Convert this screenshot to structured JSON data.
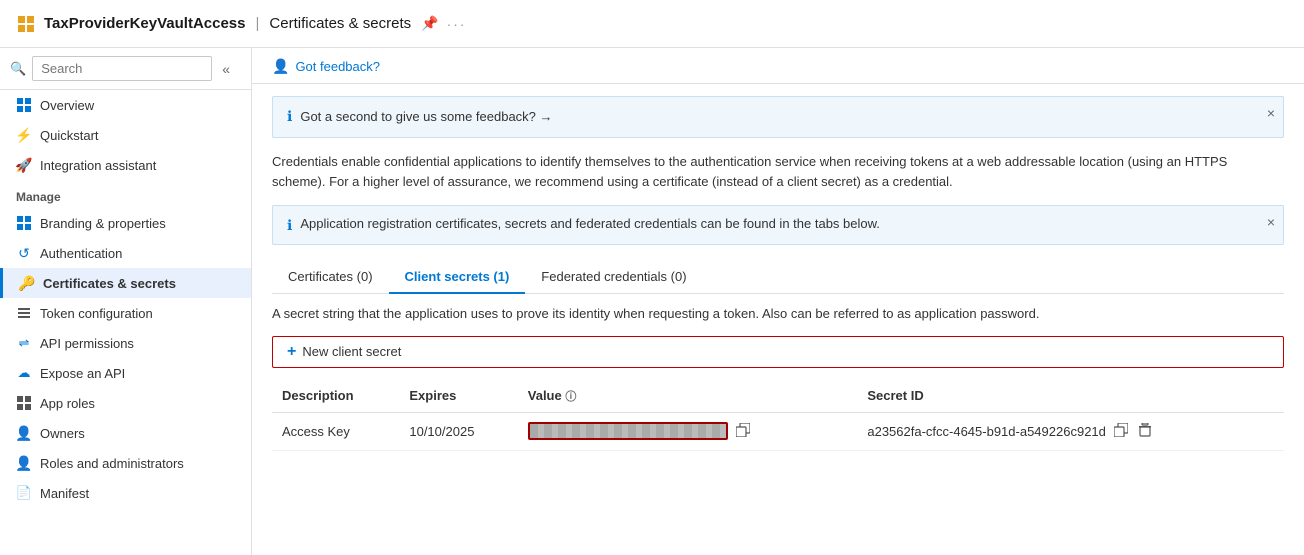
{
  "topbar": {
    "app_name": "TaxProviderKeyVaultAccess",
    "separator": "|",
    "page_title": "Certificates & secrets",
    "pin_icon": "📌",
    "more_icon": "..."
  },
  "sidebar": {
    "search_placeholder": "Search",
    "collapse_label": "«",
    "section_manage": "Manage",
    "items": [
      {
        "id": "overview",
        "label": "Overview",
        "icon": "grid"
      },
      {
        "id": "quickstart",
        "label": "Quickstart",
        "icon": "lightning"
      },
      {
        "id": "integration",
        "label": "Integration assistant",
        "icon": "rocket"
      },
      {
        "id": "branding",
        "label": "Branding & properties",
        "icon": "grid"
      },
      {
        "id": "authentication",
        "label": "Authentication",
        "icon": "refresh"
      },
      {
        "id": "certs",
        "label": "Certificates & secrets",
        "icon": "key",
        "active": true
      },
      {
        "id": "token",
        "label": "Token configuration",
        "icon": "bars"
      },
      {
        "id": "api",
        "label": "API permissions",
        "icon": "link"
      },
      {
        "id": "expose",
        "label": "Expose an API",
        "icon": "cloud"
      },
      {
        "id": "approles",
        "label": "App roles",
        "icon": "grid"
      },
      {
        "id": "owners",
        "label": "Owners",
        "icon": "person"
      },
      {
        "id": "roles",
        "label": "Roles and administrators",
        "icon": "person"
      },
      {
        "id": "manifest",
        "label": "Manifest",
        "icon": "file"
      }
    ]
  },
  "content": {
    "feedback_label": "Got feedback?",
    "banner1": {
      "text": "Got a second to give us some feedback? →",
      "close": "×"
    },
    "description": "Credentials enable confidential applications to identify themselves to the authentication service when receiving tokens at a web addressable location (using an HTTPS scheme). For a higher level of assurance, we recommend using a certificate (instead of a client secret) as a credential.",
    "banner2": {
      "text": "Application registration certificates, secrets and federated credentials can be found in the tabs below.",
      "close": "×"
    },
    "tabs": [
      {
        "id": "certs",
        "label": "Certificates (0)",
        "active": false
      },
      {
        "id": "client-secrets",
        "label": "Client secrets (1)",
        "active": true
      },
      {
        "id": "federated",
        "label": "Federated credentials (0)",
        "active": false
      }
    ],
    "tab_description": "A secret string that the application uses to prove its identity when requesting a token. Also can be referred to as application password.",
    "add_btn_label": "New client secret",
    "table": {
      "headers": [
        "Description",
        "Expires",
        "Value",
        "Secret ID"
      ],
      "value_header_tooltip": "ⓘ",
      "rows": [
        {
          "description": "Access Key",
          "expires": "10/10/2025",
          "value_masked": true,
          "secret_id": "a23562fa-cfcc-4645-b91d-a549226c921d"
        }
      ]
    }
  }
}
